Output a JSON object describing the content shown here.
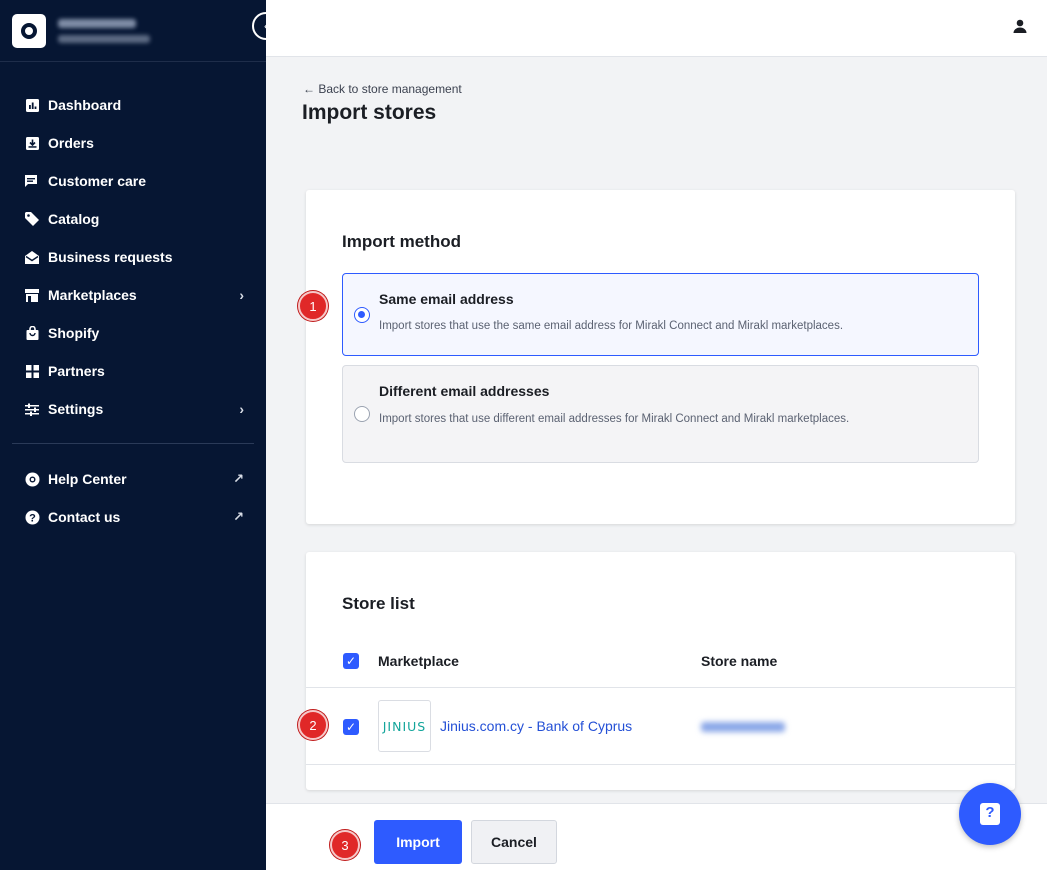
{
  "sidebar": {
    "collapse_glyph": "‹",
    "nav": [
      {
        "label": "Dashboard",
        "icon": "dashboard-icon"
      },
      {
        "label": "Orders",
        "icon": "orders-icon"
      },
      {
        "label": "Customer care",
        "icon": "chat-icon"
      },
      {
        "label": "Catalog",
        "icon": "tag-icon"
      },
      {
        "label": "Business requests",
        "icon": "envelope-open-icon"
      },
      {
        "label": "Marketplaces",
        "icon": "store-icon",
        "chevron": "›"
      },
      {
        "label": "Shopify",
        "icon": "shopping-bag-icon"
      },
      {
        "label": "Partners",
        "icon": "grid-icon"
      },
      {
        "label": "Settings",
        "icon": "sliders-icon",
        "chevron": "›"
      }
    ],
    "secondary": [
      {
        "label": "Help Center",
        "icon": "lifebuoy-icon",
        "ext": "↗"
      },
      {
        "label": "Contact us",
        "icon": "question-circle-icon",
        "ext": "↗"
      }
    ]
  },
  "page": {
    "back_link": "← Back to store management",
    "title": "Import stores"
  },
  "import_method": {
    "title": "Import method",
    "options": [
      {
        "title": "Same email address",
        "desc": "Import stores that use the same email address for Mirakl Connect and Mirakl marketplaces.",
        "selected": true
      },
      {
        "title": "Different email addresses",
        "desc": "Import stores that use different email addresses for Mirakl Connect and Mirakl marketplaces.",
        "selected": false
      }
    ]
  },
  "store_list": {
    "title": "Store list",
    "headers": {
      "marketplace": "Marketplace",
      "store_name": "Store name"
    },
    "rows": [
      {
        "logo_text": "JINIUS",
        "marketplace": "Jinius.com.cy - Bank of Cyprus",
        "checked": true
      }
    ]
  },
  "footer": {
    "import_label": "Import",
    "cancel_label": "Cancel"
  },
  "help_fab": {
    "glyph": "?"
  },
  "markers": {
    "m1": "1",
    "m2": "2",
    "m3": "3"
  },
  "check_glyph": "✓",
  "colors": {
    "sidebar_bg": "#061633",
    "accent": "#2e5bff",
    "marker_red": "#e02828"
  }
}
